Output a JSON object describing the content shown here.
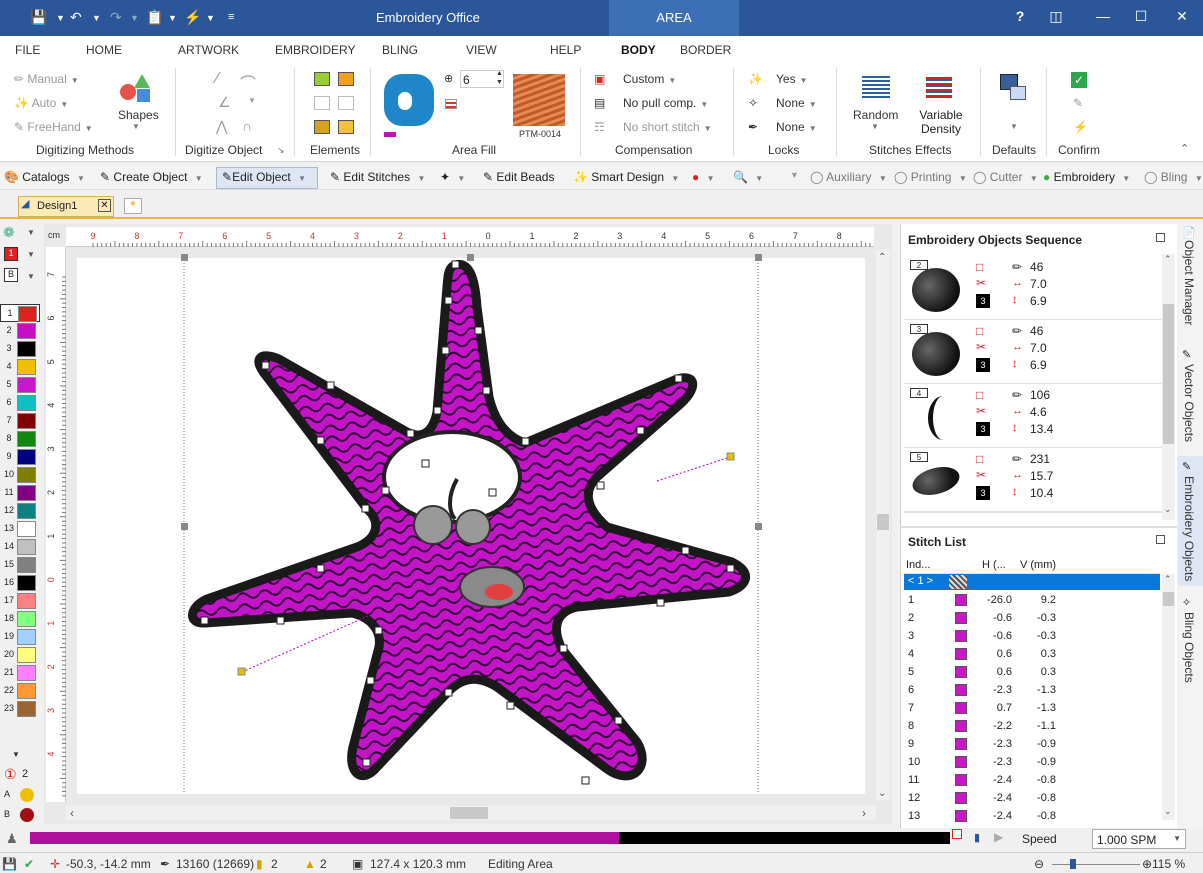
{
  "app": {
    "title": "Embroidery Office",
    "context_tab": "AREA"
  },
  "menu": [
    "FILE",
    "HOME",
    "ARTWORK",
    "EMBROIDERY",
    "BLING",
    "VIEW",
    "HELP",
    "BODY",
    "BORDER"
  ],
  "menu_active": "BODY",
  "ribbon": {
    "digitizing": {
      "manual": "Manual",
      "auto": "Auto",
      "freehand": "FreeHand",
      "shapes": "Shapes",
      "label": "Digitizing Methods"
    },
    "digitize_object": {
      "label": "Digitize Object"
    },
    "elements": {
      "label": "Elements"
    },
    "area_fill": {
      "density_value": "6",
      "pattern_name": "PTM-0014",
      "label": "Area Fill"
    },
    "compensation": {
      "custom": "Custom",
      "no_pull": "No pull comp.",
      "no_short": "No short stitch",
      "label": "Compensation"
    },
    "locks": {
      "yes": "Yes",
      "none1": "None",
      "none2": "None",
      "label": "Locks"
    },
    "stitch_effects": {
      "random": "Random",
      "variable_density": "Variable Density",
      "label": "Stitches Effects"
    },
    "defaults": {
      "label": "Defaults"
    },
    "confirm": {
      "label": "Confirm"
    }
  },
  "toolbar2": {
    "catalogs": "Catalogs",
    "create_object": "Create Object",
    "edit_object": "Edit Object",
    "edit_stitches": "Edit Stitches",
    "edit_beads": "Edit Beads",
    "smart_design": "Smart Design",
    "auxiliary": "Auxiliary",
    "printing": "Printing",
    "cutter": "Cutter",
    "embroidery": "Embroidery",
    "bling": "Bling"
  },
  "doc_tab": "Design1",
  "palette": {
    "indices": [
      "1",
      "2",
      "3",
      "4",
      "5",
      "6",
      "7",
      "8",
      "9",
      "10",
      "11",
      "12",
      "13",
      "14",
      "15",
      "16",
      "17",
      "18",
      "19",
      "20",
      "21",
      "22",
      "23"
    ],
    "colors": [
      "#e0201c",
      "#c40fc4",
      "#000000",
      "#f0c000",
      "#c816c8",
      "#10c0c0",
      "#800000",
      "#108810",
      "#000080",
      "#808000",
      "#800080",
      "#108080",
      "#ffffff",
      "#c0c0c0",
      "#808080",
      "#000000",
      "#ff8080",
      "#80ff80",
      "#a0d0ff",
      "#ffff80",
      "#ff80ff",
      "#ff9933",
      "#996633"
    ],
    "count_label": "2"
  },
  "ruler_h": [
    "9",
    "8",
    "7",
    "6",
    "5",
    "4",
    "3",
    "2",
    "1",
    "0",
    "1",
    "2",
    "3",
    "4",
    "5",
    "6",
    "7",
    "8"
  ],
  "ruler_v": [
    "7",
    "6",
    "5",
    "4",
    "3",
    "2",
    "1",
    "0",
    "1",
    "2",
    "3",
    "4"
  ],
  "sequence_panel": {
    "title": "Embroidery Objects Sequence",
    "rows": [
      {
        "num": "2",
        "stitches": "46",
        "width": "7.0",
        "height": "6.9",
        "color_idx": "3"
      },
      {
        "num": "3",
        "stitches": "46",
        "width": "7.0",
        "height": "6.9",
        "color_idx": "3"
      },
      {
        "num": "4",
        "stitches": "106",
        "width": "4.6",
        "height": "13.4",
        "color_idx": "3"
      },
      {
        "num": "5",
        "stitches": "231",
        "width": "15.7",
        "height": "10.4",
        "color_idx": "3"
      }
    ]
  },
  "stitch_list": {
    "title": "Stitch List",
    "headers": [
      "Ind...",
      "H (...",
      "V (mm)"
    ],
    "selected_label": "< 1 >",
    "rows": [
      [
        "1",
        "-26.0",
        "9.2"
      ],
      [
        "2",
        "-0.6",
        "-0.3"
      ],
      [
        "3",
        "-0.6",
        "-0.3"
      ],
      [
        "4",
        "0.6",
        "0.3"
      ],
      [
        "5",
        "0.6",
        "0.3"
      ],
      [
        "6",
        "-2.3",
        "-1.3"
      ],
      [
        "7",
        "0.7",
        "-1.3"
      ],
      [
        "8",
        "-2.2",
        "-1.1"
      ],
      [
        "9",
        "-2.3",
        "-0.9"
      ],
      [
        "10",
        "-2.3",
        "-0.9"
      ],
      [
        "11",
        "-2.4",
        "-0.8"
      ],
      [
        "12",
        "-2.4",
        "-0.8"
      ],
      [
        "13",
        "-2.4",
        "-0.8"
      ]
    ]
  },
  "side_tabs": [
    "Object Manager",
    "Vector Objects",
    "Embroidery Objects",
    "Bling Objects"
  ],
  "player": {
    "progress": 0.64,
    "speed_label": "Speed",
    "speed_value": "1.000 SPM"
  },
  "status": {
    "coords": "-50.3, -14.2 mm",
    "stitches": "13160 (12669)",
    "colors": "2",
    "objects": "2",
    "size": "127.4 x 120.3 mm",
    "mode": "Editing Area",
    "zoom": "115 %"
  }
}
